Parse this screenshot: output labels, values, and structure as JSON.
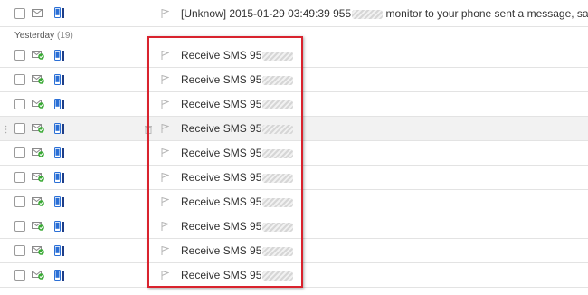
{
  "colors": {
    "highlight_border": "#d9232e",
    "row_border": "#e3e3e3",
    "hover_row": "#f2f2f2",
    "phone_icon": "#2a6fd6",
    "envelope_check": "#3aaa35"
  },
  "icons": [
    "checkbox",
    "envelope-check-icon",
    "phone-icon",
    "flag-icon",
    "trash-icon",
    "drag-handle-icon"
  ],
  "top_message": {
    "subject_prefix": "[Unknow] 2015-01-29 03:49:39 955",
    "subject_suffix": " monitor to your phone sent a message, says:"
  },
  "group": {
    "name": "Yesterday",
    "count": "(19)"
  },
  "messages": [
    {
      "subject": "Receive SMS 95"
    },
    {
      "subject": "Receive SMS 95"
    },
    {
      "subject": "Receive SMS 95"
    },
    {
      "subject": "Receive SMS 95"
    },
    {
      "subject": "Receive SMS 95"
    },
    {
      "subject": "Receive SMS 95"
    },
    {
      "subject": "Receive SMS 95"
    },
    {
      "subject": "Receive SMS 95"
    },
    {
      "subject": "Receive SMS 95"
    },
    {
      "subject": "Receive SMS 95"
    }
  ]
}
